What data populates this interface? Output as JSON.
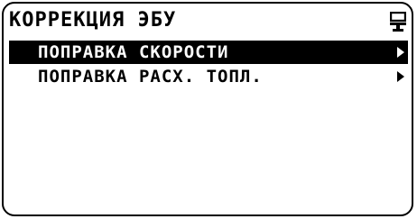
{
  "header": {
    "title": "КОРРЕКЦИЯ ЭБУ",
    "icon": "device-icon"
  },
  "menu": {
    "items": [
      {
        "label": "ПОПРАВКА СКОРОСТИ",
        "selected": true,
        "icon": "chevron-right-icon"
      },
      {
        "label": "ПОПРАВКА РАСХ. ТОПЛ.",
        "selected": false,
        "icon": "chevron-right-icon"
      }
    ]
  },
  "colors": {
    "background": "#ffffff",
    "foreground": "#000000",
    "highlight": "#000000",
    "highlight_text": "#ffffff"
  }
}
